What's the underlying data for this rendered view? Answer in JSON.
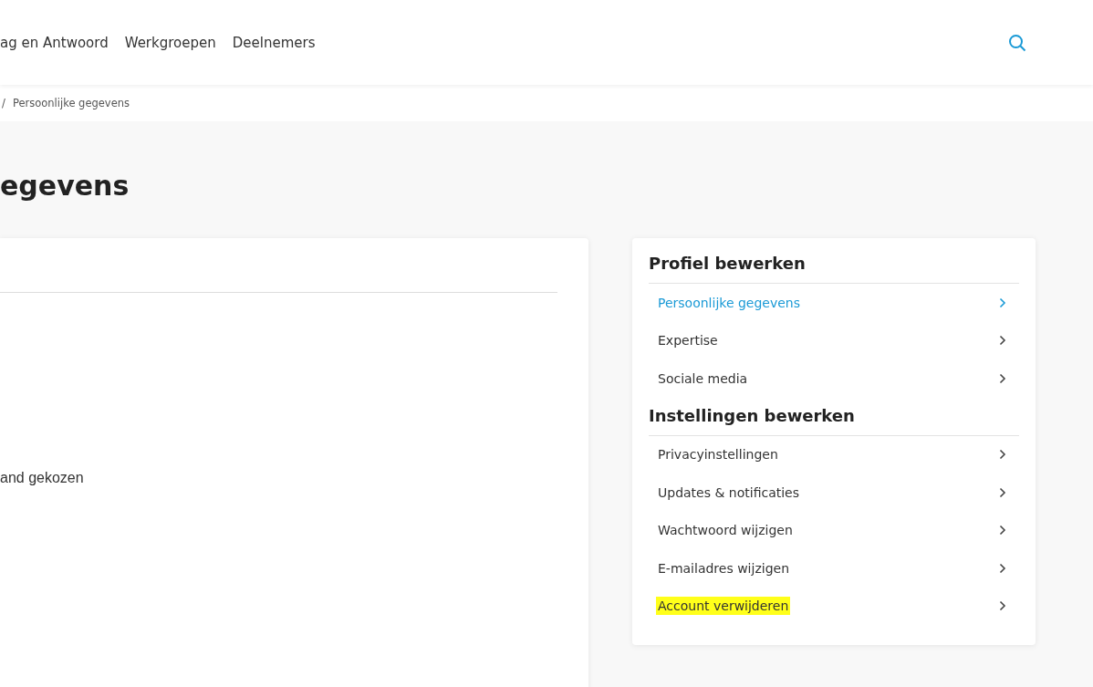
{
  "nav": {
    "items": [
      {
        "label": "ag en Antwoord"
      },
      {
        "label": "Werkgroepen"
      },
      {
        "label": "Deelnemers"
      }
    ]
  },
  "breadcrumb": {
    "separator": "/",
    "current": "Persoonlijke gegevens"
  },
  "page_title": "egevens",
  "main_card": {
    "text": "and gekozen"
  },
  "sidebar": {
    "sections": [
      {
        "title": "Profiel bewerken",
        "items": [
          {
            "label": "Persoonlijke gegevens",
            "selected": true,
            "highlighted": false
          },
          {
            "label": "Expertise",
            "selected": false,
            "highlighted": false
          },
          {
            "label": "Sociale media",
            "selected": false,
            "highlighted": false
          }
        ]
      },
      {
        "title": "Instellingen bewerken",
        "items": [
          {
            "label": "Privacyinstellingen",
            "selected": false,
            "highlighted": false
          },
          {
            "label": "Updates & notificaties",
            "selected": false,
            "highlighted": false
          },
          {
            "label": "Wachtwoord wijzigen",
            "selected": false,
            "highlighted": false
          },
          {
            "label": "E-mailadres wijzigen",
            "selected": false,
            "highlighted": false
          },
          {
            "label": "Account verwijderen",
            "selected": false,
            "highlighted": true
          }
        ]
      }
    ]
  }
}
